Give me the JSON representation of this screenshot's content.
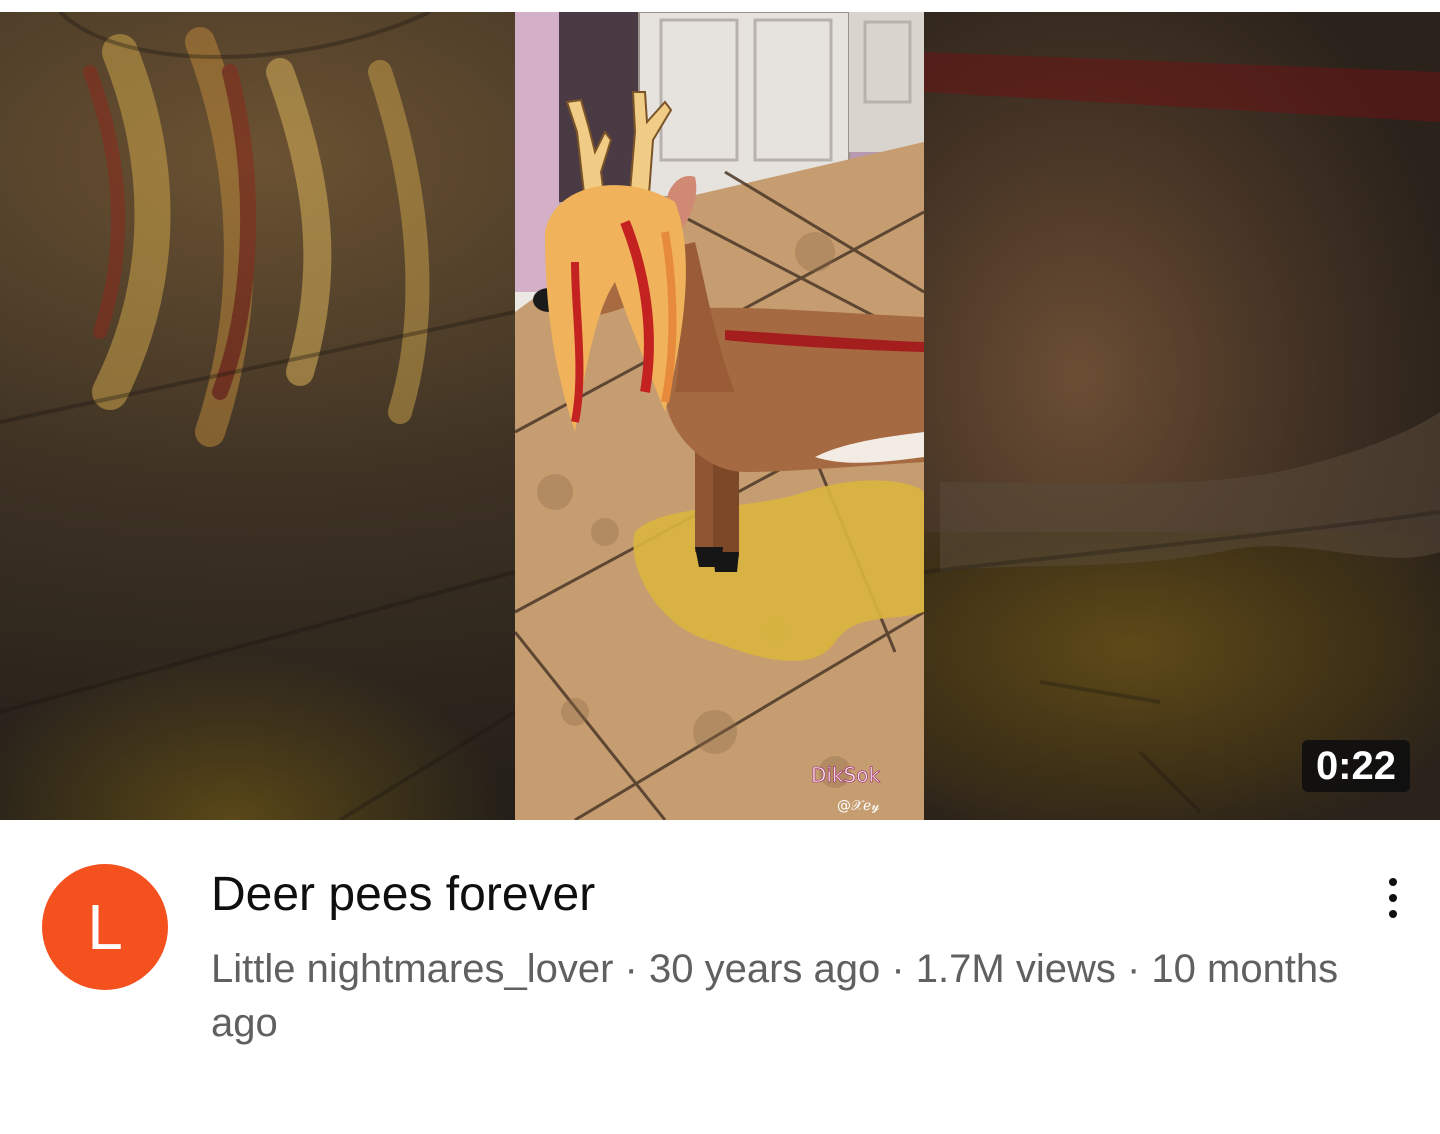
{
  "video": {
    "duration": "0:22",
    "watermark_text": "DikSok",
    "watermark_handle": "@𝒳ℯ𝓎"
  },
  "channel": {
    "avatar_letter": "L",
    "avatar_color": "#f4511e"
  },
  "title": "Deer pees forever",
  "metadata": "Little nightmares_lover · 30 years ago · 1.7M views · 10 months ago",
  "icons": {
    "more": "more-vert-icon"
  }
}
